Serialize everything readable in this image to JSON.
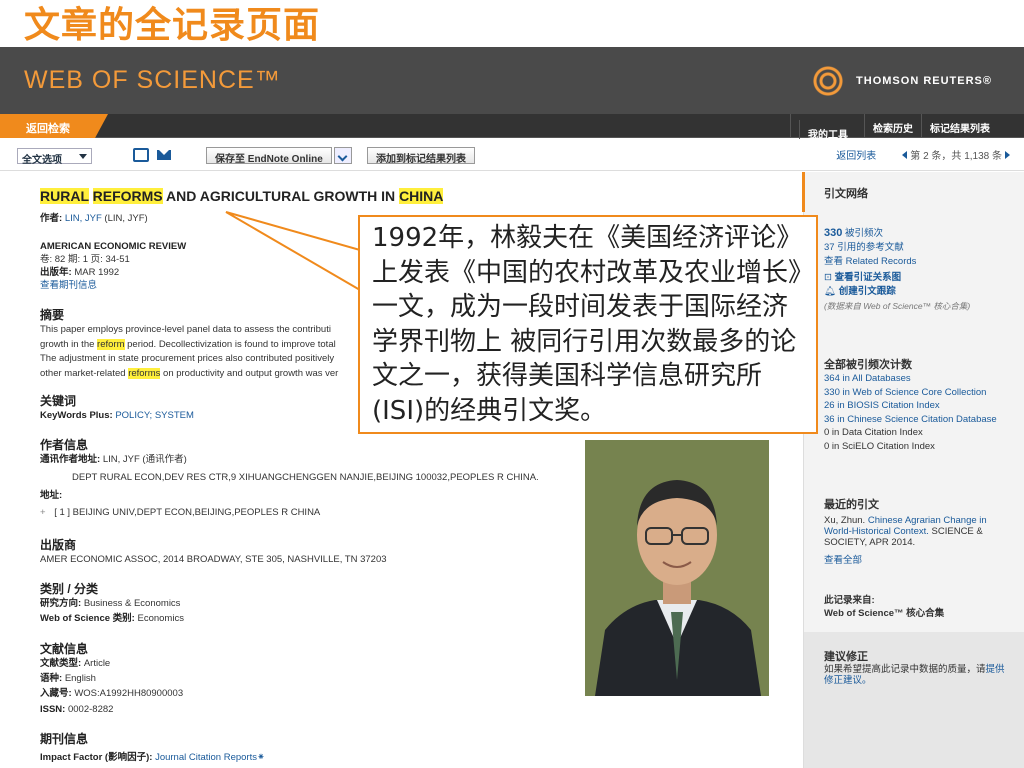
{
  "slide_title": "文章的全记录页面",
  "header": {
    "logo": "WEB OF SCIENCE™",
    "partner": "THOMSON REUTERS®",
    "partner_icon": "thomson-reuters-logo-icon"
  },
  "nav": {
    "back": "返回检索",
    "right": [
      "我的工具",
      "检索历史",
      "标记结果列表"
    ]
  },
  "toolbar": {
    "full_text": "全文选项",
    "save_endnote": "保存至 EndNote Online",
    "add_marked": "添加到标记结果列表",
    "back_list": "返回列表",
    "paging": "第 2 条，共 1,138 条"
  },
  "article": {
    "title_parts": {
      "p1": "RURAL",
      "p2": "REFORMS",
      "p3": " AND AGRICULTURAL GROWTH IN ",
      "p4": "CHINA"
    },
    "author_label": "作者:",
    "author_value": "LIN, JYF",
    "author_full": " (LIN, JYF)",
    "journal": "AMERICAN ECONOMIC REVIEW",
    "volume_line": "卷: 82  期: 1  页: 34-51",
    "year_label": "出版年:",
    "year_value": "MAR 1992",
    "journal_info": "查看期刊信息",
    "abstract_h": "摘要",
    "abstract": {
      "l1": "This paper employs province-level panel data to assess the contributi",
      "l2a": "growth in the ",
      "l2b": "reform",
      "l2c": " period. Decollectivization is found to improve total",
      "l3": "The adjustment in state procurement prices also contributed positively",
      "l4a": "other market-related ",
      "l4b": "reforms",
      "l4c": " on productivity and output growth was ver"
    },
    "keywords_h": "关键词",
    "keywords_label": "KeyWords Plus:",
    "keywords_value": "POLICY; SYSTEM",
    "author_info_h": "作者信息",
    "corr_label": "通讯作者地址:",
    "corr_value": "LIN, JYF (通讯作者)",
    "corr_addr": "DEPT RURAL ECON,DEV RES CTR,9 XIHUANGCHENGGEN NANJIE,BEIJING 100032,PEOPLES R CHINA.",
    "addr_label": "地址:",
    "addr_value": "[ 1 ] BEIJING UNIV,DEPT ECON,BEIJING,PEOPLES R CHINA",
    "publisher_h": "出版商",
    "publisher": "AMER ECONOMIC ASSOC, 2014 BROADWAY, STE 305, NASHVILLE, TN 37203",
    "category_h": "类别 / 分类",
    "research_label": "研究方向:",
    "research_value": "Business & Economics",
    "wos_cat_label": "Web of Science 类别:",
    "wos_cat_value": "Economics",
    "doc_info_h": "文献信息",
    "doctype_label": "文献类型:",
    "doctype_value": "Article",
    "lang_label": "语种:",
    "lang_value": "English",
    "acc_label": "入藏号:",
    "acc_value": "WOS:A1992HH80900003",
    "issn_label": "ISSN:",
    "issn_value": "0002-8282",
    "journal_info_h": "期刊信息",
    "impact_label": "Impact Factor (影响因子):",
    "impact_value": "Journal Citation Reports"
  },
  "callout": "1992年，林毅夫在《美国经济评论》上发表《中国的农村改革及农业增长》一文，成为一段时间发表于国际经济学界刊物上 被同行引用次数最多的论文之一，获得美国科学信息研究所(ISI)的经典引文奖。",
  "sidebar": {
    "network_h": "引文网络",
    "cited_num": "330",
    "cited_label": " 被引频次",
    "refs": "37 引用的参考文献",
    "related": "查看 Related Records",
    "cite_map": "查看引证关系图",
    "alert": "创建引文跟踪",
    "note": "(数据来自 Web of Science™ 核心合集)",
    "all_counts_h": "全部被引频次计数",
    "counts": [
      "364 in All Databases",
      "330 in Web of Science Core Collection",
      "26 in BIOSIS Citation Index",
      "36 in Chinese Science Citation Database",
      "0 in Data Citation Index",
      "0 in SciELO Citation Index"
    ],
    "recent_h": "最近的引文",
    "recent_author": "Xu, Zhun.",
    "recent_title": "Chinese Agrarian Change in World-Historical Context.",
    "recent_src": "SCIENCE & SOCIETY, APR 2014.",
    "view_all": "查看全部",
    "from_h": "此记录来自:",
    "from_v": "Web of Science™ 核心合集",
    "suggest_h": "建议修正",
    "suggest_t": "如果希望提高此记录中数据的质量，请",
    "suggest_link": "提供修正建议。"
  },
  "colors": {
    "accent": "#f08a1c",
    "link": "#1a5a9a",
    "highlight": "#ffef3c",
    "header": "#4a4a4a"
  }
}
